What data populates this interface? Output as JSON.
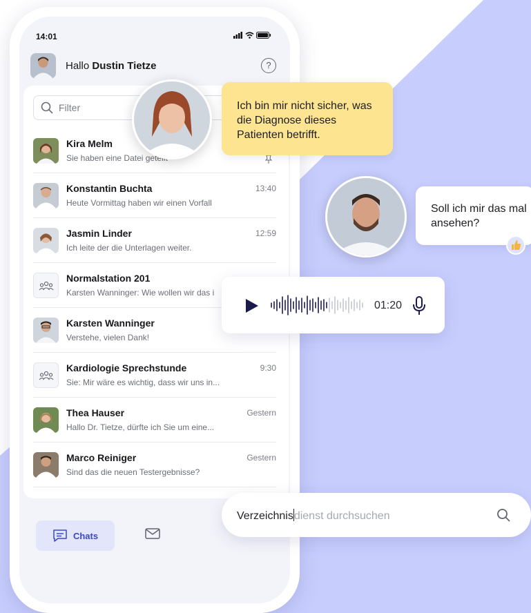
{
  "status_bar": {
    "time": "14:01"
  },
  "header": {
    "greeting": "Hallo",
    "user_name": "Dustin Tietze"
  },
  "filter": {
    "placeholder": "Filter"
  },
  "chats": [
    {
      "name": "Kira Melm",
      "preview": "Sie haben eine Datei geteilt",
      "time": "",
      "pinned": true,
      "type": "person"
    },
    {
      "name": "Konstantin Buchta",
      "preview": "Heute Vormittag haben wir einen Vorfall",
      "time": "13:40",
      "type": "person"
    },
    {
      "name": "Jasmin Linder",
      "preview": "Ich leite der die Unterlagen weiter.",
      "time": "12:59",
      "type": "person"
    },
    {
      "name": "Normalstation 201",
      "preview": "Karsten Wanninger: Wie wollen wir das i",
      "time": "",
      "type": "group"
    },
    {
      "name": "Karsten Wanninger",
      "preview": "Verstehe, vielen Dank!",
      "time": "",
      "type": "person"
    },
    {
      "name": "Kardiologie Sprechstunde",
      "preview": "Sie: Mir wäre es wichtig, dass wir uns in...",
      "time": "9:30",
      "type": "group"
    },
    {
      "name": "Thea Hauser",
      "preview": "Hallo Dr. Tietze, dürfte ich Sie um eine...",
      "time": "Gestern",
      "type": "person"
    },
    {
      "name": "Marco Reiniger",
      "preview": "Sind das die neuen Testergebnisse?",
      "time": "Gestern",
      "type": "person"
    }
  ],
  "bottom_nav": {
    "chats_label": "Chats"
  },
  "bubbles": {
    "doctor_message": "Ich bin mir nicht sicher, was die Diagnose dieses Patienten betrifft.",
    "reply_message": "Soll ich mir das mal ansehen?"
  },
  "voice_message": {
    "duration": "01:20"
  },
  "search": {
    "typed": "Verzeichnis",
    "suggestion": "dienst durchsuchen"
  },
  "colors": {
    "background_accent": "#c7cdfd",
    "bubble_yellow": "#fde490",
    "nav_active": "#e3e5fb",
    "voice_dark": "#1b1b4b"
  }
}
